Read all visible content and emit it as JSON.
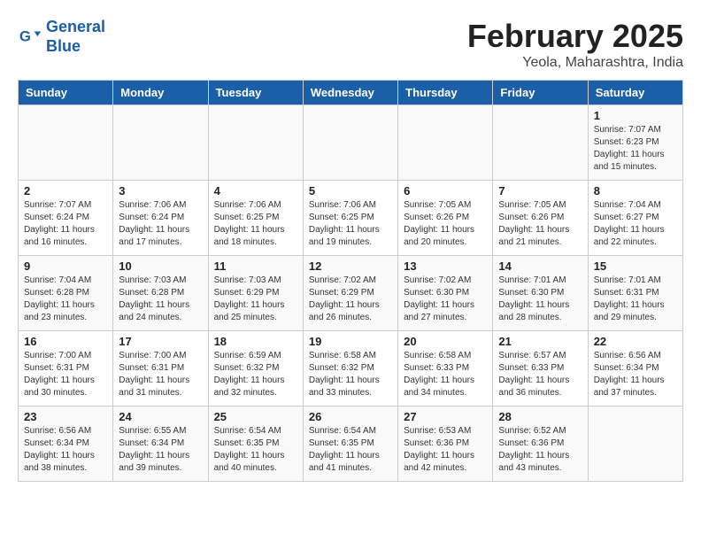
{
  "header": {
    "logo_line1": "General",
    "logo_line2": "Blue",
    "month_title": "February 2025",
    "subtitle": "Yeola, Maharashtra, India"
  },
  "days_of_week": [
    "Sunday",
    "Monday",
    "Tuesday",
    "Wednesday",
    "Thursday",
    "Friday",
    "Saturday"
  ],
  "weeks": [
    [
      {
        "day": "",
        "info": ""
      },
      {
        "day": "",
        "info": ""
      },
      {
        "day": "",
        "info": ""
      },
      {
        "day": "",
        "info": ""
      },
      {
        "day": "",
        "info": ""
      },
      {
        "day": "",
        "info": ""
      },
      {
        "day": "1",
        "info": "Sunrise: 7:07 AM\nSunset: 6:23 PM\nDaylight: 11 hours and 15 minutes."
      }
    ],
    [
      {
        "day": "2",
        "info": "Sunrise: 7:07 AM\nSunset: 6:24 PM\nDaylight: 11 hours and 16 minutes."
      },
      {
        "day": "3",
        "info": "Sunrise: 7:06 AM\nSunset: 6:24 PM\nDaylight: 11 hours and 17 minutes."
      },
      {
        "day": "4",
        "info": "Sunrise: 7:06 AM\nSunset: 6:25 PM\nDaylight: 11 hours and 18 minutes."
      },
      {
        "day": "5",
        "info": "Sunrise: 7:06 AM\nSunset: 6:25 PM\nDaylight: 11 hours and 19 minutes."
      },
      {
        "day": "6",
        "info": "Sunrise: 7:05 AM\nSunset: 6:26 PM\nDaylight: 11 hours and 20 minutes."
      },
      {
        "day": "7",
        "info": "Sunrise: 7:05 AM\nSunset: 6:26 PM\nDaylight: 11 hours and 21 minutes."
      },
      {
        "day": "8",
        "info": "Sunrise: 7:04 AM\nSunset: 6:27 PM\nDaylight: 11 hours and 22 minutes."
      }
    ],
    [
      {
        "day": "9",
        "info": "Sunrise: 7:04 AM\nSunset: 6:28 PM\nDaylight: 11 hours and 23 minutes."
      },
      {
        "day": "10",
        "info": "Sunrise: 7:03 AM\nSunset: 6:28 PM\nDaylight: 11 hours and 24 minutes."
      },
      {
        "day": "11",
        "info": "Sunrise: 7:03 AM\nSunset: 6:29 PM\nDaylight: 11 hours and 25 minutes."
      },
      {
        "day": "12",
        "info": "Sunrise: 7:02 AM\nSunset: 6:29 PM\nDaylight: 11 hours and 26 minutes."
      },
      {
        "day": "13",
        "info": "Sunrise: 7:02 AM\nSunset: 6:30 PM\nDaylight: 11 hours and 27 minutes."
      },
      {
        "day": "14",
        "info": "Sunrise: 7:01 AM\nSunset: 6:30 PM\nDaylight: 11 hours and 28 minutes."
      },
      {
        "day": "15",
        "info": "Sunrise: 7:01 AM\nSunset: 6:31 PM\nDaylight: 11 hours and 29 minutes."
      }
    ],
    [
      {
        "day": "16",
        "info": "Sunrise: 7:00 AM\nSunset: 6:31 PM\nDaylight: 11 hours and 30 minutes."
      },
      {
        "day": "17",
        "info": "Sunrise: 7:00 AM\nSunset: 6:31 PM\nDaylight: 11 hours and 31 minutes."
      },
      {
        "day": "18",
        "info": "Sunrise: 6:59 AM\nSunset: 6:32 PM\nDaylight: 11 hours and 32 minutes."
      },
      {
        "day": "19",
        "info": "Sunrise: 6:58 AM\nSunset: 6:32 PM\nDaylight: 11 hours and 33 minutes."
      },
      {
        "day": "20",
        "info": "Sunrise: 6:58 AM\nSunset: 6:33 PM\nDaylight: 11 hours and 34 minutes."
      },
      {
        "day": "21",
        "info": "Sunrise: 6:57 AM\nSunset: 6:33 PM\nDaylight: 11 hours and 36 minutes."
      },
      {
        "day": "22",
        "info": "Sunrise: 6:56 AM\nSunset: 6:34 PM\nDaylight: 11 hours and 37 minutes."
      }
    ],
    [
      {
        "day": "23",
        "info": "Sunrise: 6:56 AM\nSunset: 6:34 PM\nDaylight: 11 hours and 38 minutes."
      },
      {
        "day": "24",
        "info": "Sunrise: 6:55 AM\nSunset: 6:34 PM\nDaylight: 11 hours and 39 minutes."
      },
      {
        "day": "25",
        "info": "Sunrise: 6:54 AM\nSunset: 6:35 PM\nDaylight: 11 hours and 40 minutes."
      },
      {
        "day": "26",
        "info": "Sunrise: 6:54 AM\nSunset: 6:35 PM\nDaylight: 11 hours and 41 minutes."
      },
      {
        "day": "27",
        "info": "Sunrise: 6:53 AM\nSunset: 6:36 PM\nDaylight: 11 hours and 42 minutes."
      },
      {
        "day": "28",
        "info": "Sunrise: 6:52 AM\nSunset: 6:36 PM\nDaylight: 11 hours and 43 minutes."
      },
      {
        "day": "",
        "info": ""
      }
    ]
  ]
}
